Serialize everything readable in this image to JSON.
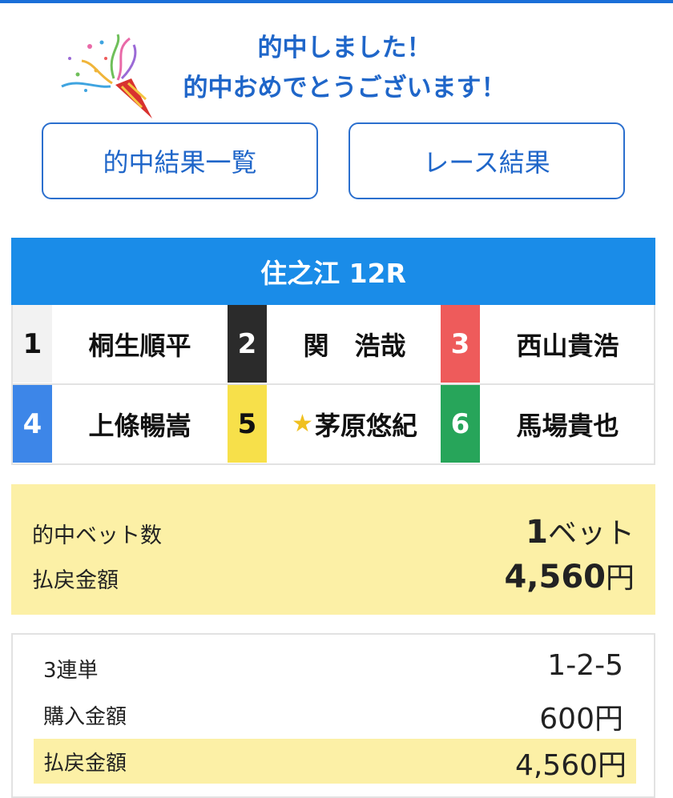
{
  "banner": {
    "line1": "的中しました！",
    "line2": "的中おめでとうございます！"
  },
  "nav": {
    "hit_list_label": "的中結果一覧",
    "race_result_label": "レース結果"
  },
  "race": {
    "title": "住之江 12R",
    "entries": [
      {
        "number": "1",
        "name": "桐生順平",
        "bg": "#f2f2f2",
        "fg": "#111111",
        "starred": false
      },
      {
        "number": "2",
        "name": "関　浩哉",
        "bg": "#2b2b2b",
        "fg": "#ffffff",
        "starred": false
      },
      {
        "number": "3",
        "name": "西山貴浩",
        "bg": "#ee5b5b",
        "fg": "#ffffff",
        "starred": false
      },
      {
        "number": "4",
        "name": "上條暢嵩",
        "bg": "#3d86e8",
        "fg": "#ffffff",
        "starred": false
      },
      {
        "number": "5",
        "name": "茅原悠紀",
        "bg": "#f7e04a",
        "fg": "#111111",
        "starred": true
      },
      {
        "number": "6",
        "name": "馬場貴也",
        "bg": "#27a55a",
        "fg": "#ffffff",
        "starred": false
      }
    ]
  },
  "summary": {
    "bets_label": "的中ベット数",
    "bets_count": "1",
    "bets_unit": "ベット",
    "payout_label": "払戻金額",
    "payout_amount": "4,560",
    "payout_unit": "円",
    "bg_color": "#fcf0a6"
  },
  "detail": {
    "type_label": "3連単",
    "type_value": "1-2-5",
    "purchase_label": "購入金額",
    "purchase_value": "600円",
    "payout_label": "払戻金額",
    "payout_value": "4,560円"
  },
  "colors": {
    "accent": "#1a8ce8",
    "text_blue": "#1f66c9"
  }
}
